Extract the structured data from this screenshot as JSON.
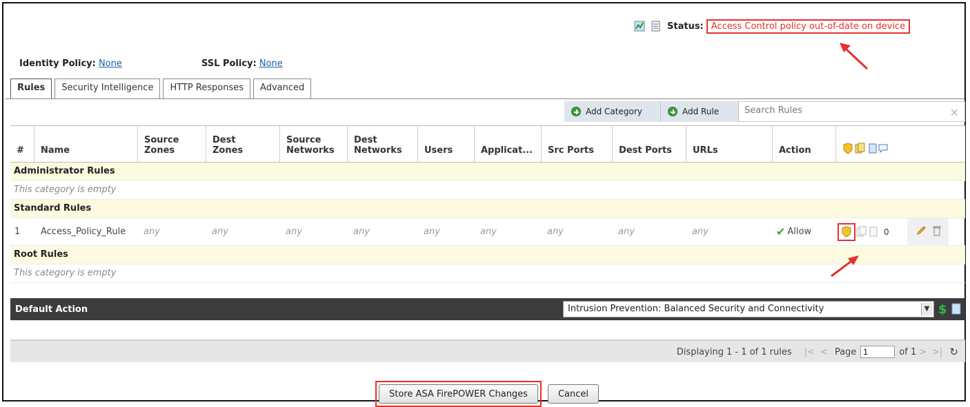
{
  "status": {
    "label": "Status:",
    "text": "Access Control policy out-of-date on device",
    "icons": [
      "report-chart-icon",
      "document-icon"
    ]
  },
  "policies": {
    "identity_label": "Identity Policy:",
    "identity_value": "None",
    "ssl_label": "SSL Policy:",
    "ssl_value": "None"
  },
  "tabs": [
    {
      "label": "Rules",
      "active": true
    },
    {
      "label": "Security Intelligence",
      "active": false
    },
    {
      "label": "HTTP Responses",
      "active": false
    },
    {
      "label": "Advanced",
      "active": false
    }
  ],
  "toolbar": {
    "add_category": "Add Category",
    "add_rule": "Add Rule",
    "search_placeholder": "Search Rules"
  },
  "table": {
    "headers": {
      "num": "#",
      "name": "Name",
      "source_zones": "Source\nZones",
      "dest_zones": "Dest\nZones",
      "source_networks": "Source\nNetworks",
      "dest_networks": "Dest\nNetworks",
      "users": "Users",
      "applications": "Applicat...",
      "src_ports": "Src Ports",
      "dest_ports": "Dest Ports",
      "urls": "URLs",
      "action": "Action"
    },
    "categories": {
      "admin": "Administrator Rules",
      "standard": "Standard Rules",
      "root": "Root Rules",
      "empty_text": "This category is empty"
    },
    "rule": {
      "num": "1",
      "name": "Access_Policy_Rule",
      "source_zones": "any",
      "dest_zones": "any",
      "source_networks": "any",
      "dest_networks": "any",
      "users": "any",
      "applications": "any",
      "src_ports": "any",
      "dest_ports": "any",
      "urls": "any",
      "action": "Allow",
      "comment_count": "0"
    }
  },
  "default_action": {
    "label": "Default Action",
    "value": "Intrusion Prevention: Balanced Security and Connectivity"
  },
  "pager": {
    "display_text": "Displaying 1 - 1 of 1 rules",
    "page_label": "Page",
    "page_value": "1",
    "of_text": "of 1"
  },
  "buttons": {
    "store": "Store ASA FirePOWER Changes",
    "cancel": "Cancel"
  },
  "colors": {
    "alert_red": "#e5302c",
    "category_bg": "#fcfadf",
    "default_action_bg": "#3c3c3c",
    "allow_green": "#3e9b3e"
  }
}
